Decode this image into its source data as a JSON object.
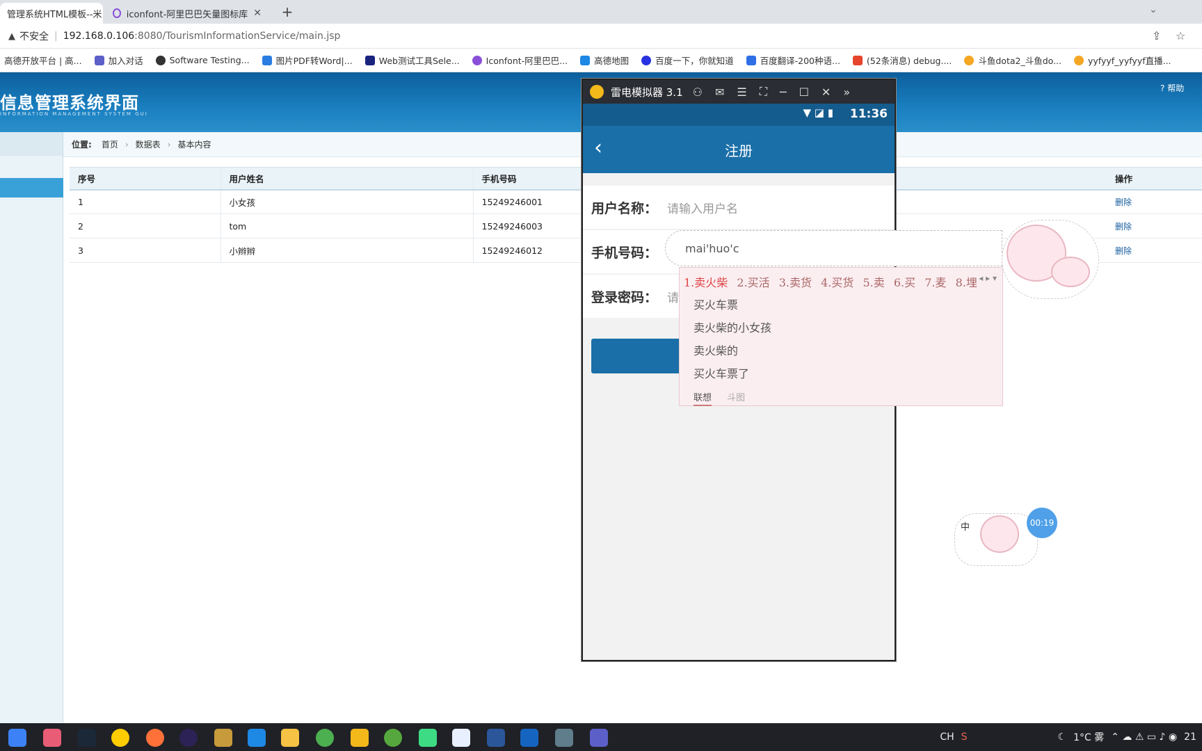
{
  "browser": {
    "tabs": [
      {
        "title": "管理系统HTML模板--米",
        "close": "✕"
      },
      {
        "title": "iconfont-阿里巴巴矢量图标库",
        "close": "✕"
      }
    ],
    "new_tab": "+",
    "address": {
      "security_label": "不安全",
      "host": "192.168.0.106",
      "path": ":8080/TourismInformationService/main.jsp"
    },
    "bookmarks": [
      {
        "label": "高德开放平台 | 高...",
        "color": "#ffffff"
      },
      {
        "label": "加入对话",
        "color": "#5b5fc7"
      },
      {
        "label": "Software Testing...",
        "color": "#333333"
      },
      {
        "label": "图片PDF转Word|...",
        "color": "#2a7de1"
      },
      {
        "label": "Web测试工具Sele...",
        "color": "#1a237e"
      },
      {
        "label": "Iconfont-阿里巴巴...",
        "color": "#8a4fd8"
      },
      {
        "label": "高德地图",
        "color": "#1e88e5"
      },
      {
        "label": "百度一下，你就知道",
        "color": "#2932e1"
      },
      {
        "label": "百度翻译-200种语...",
        "color": "#2f6fe6"
      },
      {
        "label": "(52条消息) debug....",
        "color": "#e6442c"
      },
      {
        "label": "斗鱼dota2_斗鱼do...",
        "color": "#f5a623"
      },
      {
        "label": "yyfyyf_yyfyyf直播...",
        "color": "#f5a623"
      }
    ]
  },
  "app": {
    "title": "信息管理系统界面",
    "subtitle": "INFORMATION MANAGEMENT SYSTEM GUI",
    "help": "帮助",
    "breadcrumb": {
      "label": "位置:",
      "items": [
        "首页",
        "数据表",
        "基本内容"
      ],
      "separator": "›"
    },
    "table": {
      "headers": [
        "序号",
        "用户姓名",
        "手机号码",
        "操作"
      ],
      "rows": [
        {
          "id": "1",
          "name": "小女孩",
          "phone": "15249246001",
          "action": "删除"
        },
        {
          "id": "2",
          "name": "tom",
          "phone": "15249246003",
          "action": "删除"
        },
        {
          "id": "3",
          "name": "小辫辫",
          "phone": "15249246012",
          "action": "删除"
        }
      ]
    }
  },
  "emulator": {
    "title": "雷电模拟器 3.1",
    "time": "11:36",
    "screen_title": "注册",
    "fields": [
      {
        "label": "用户名称：",
        "placeholder": "请输入用户名"
      },
      {
        "label": "手机号码：",
        "placeholder": ""
      },
      {
        "label": "登录密码：",
        "placeholder": "请"
      }
    ]
  },
  "ime": {
    "pinyin": "mai'huo'c",
    "candidates": [
      "1.卖火柴",
      "2.买活",
      "3.卖货",
      "4.买货",
      "5.卖",
      "6.买",
      "7.麦",
      "8.埋"
    ],
    "suggestions": [
      "买火车票",
      "卖火柴的小女孩",
      "卖火柴的",
      "买火车票了"
    ],
    "tabs": [
      "联想",
      "斗图"
    ],
    "mode": "中",
    "timer": "00:19"
  },
  "taskbar": {
    "tray": {
      "lang": "CH",
      "weather": "1°C 雾",
      "clock": "21"
    }
  }
}
